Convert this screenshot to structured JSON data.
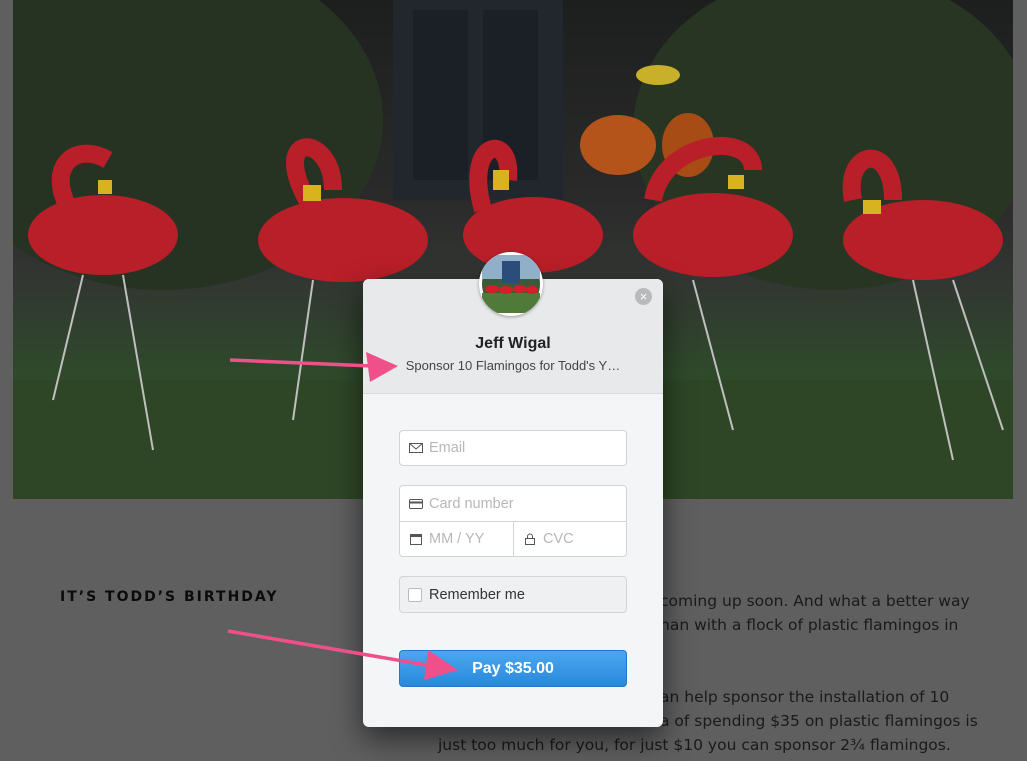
{
  "page": {
    "section_title": "IT’S TODD’S BIRTHDAY",
    "paragraph1_line1": "coming up soon. And what a better way",
    "paragraph1_line2": "han with a flock of plastic flamingos in",
    "paragraph2_line1": "an help sponsor the installation of 10",
    "paragraph2_line2": "a of spending $35 on plastic flamingos is",
    "paragraph2_line3": "just too much for you, for just $10 you can sponsor 2¾ flamingos."
  },
  "checkout": {
    "merchant_name": "Jeff Wigal",
    "description": "Sponsor 10 Flamingos for Todd's Y…",
    "email_placeholder": "Email",
    "card_placeholder": "Card number",
    "expiry_placeholder": "MM / YY",
    "cvc_placeholder": "CVC",
    "remember_label": "Remember me",
    "pay_label": "Pay $35.00",
    "close_symbol": "×"
  },
  "colors": {
    "pay_button": "#3a98e6",
    "annotation_arrow": "#f0508a",
    "flamingo": "#c0202a"
  },
  "icons": [
    "email-icon",
    "card-icon",
    "calendar-icon",
    "lock-icon",
    "close-icon"
  ]
}
